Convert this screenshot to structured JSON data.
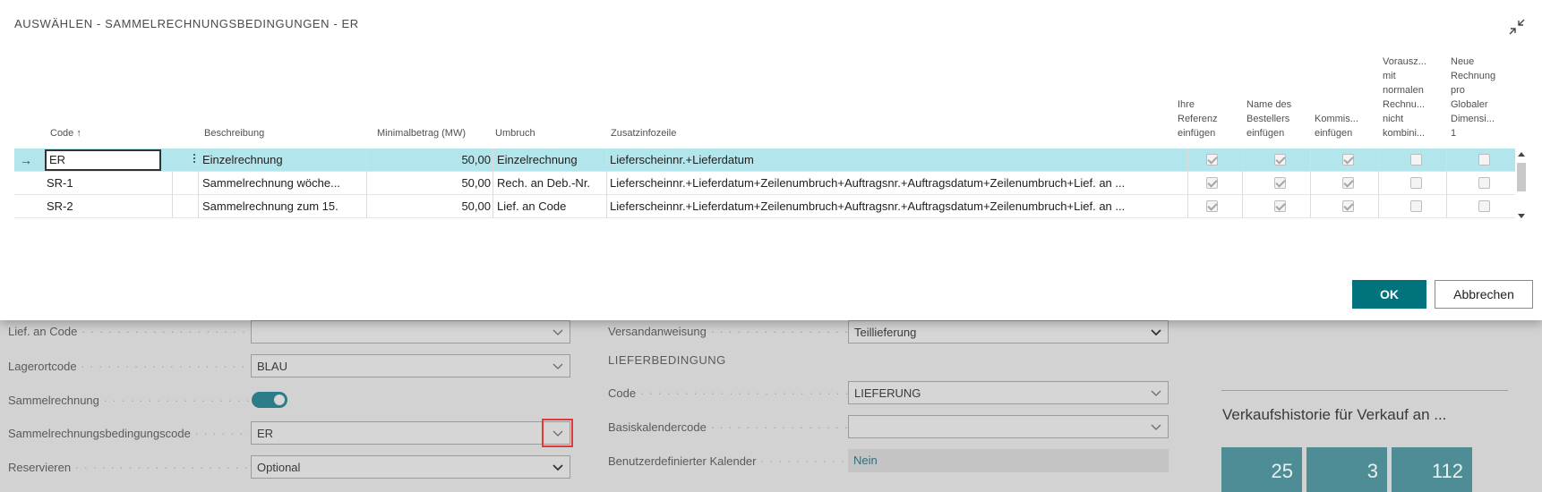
{
  "dialog": {
    "title": "AUSWÄHLEN - SAMMELRECHNUNGSBEDINGUNGEN - ER",
    "ok_label": "OK",
    "cancel_label": "Abbrechen"
  },
  "grid": {
    "columns": {
      "code": "Code",
      "sort_indicator": "↑",
      "beschreibung": "Beschreibung",
      "minimalbetrag": "Minimalbetrag (MW)",
      "umbruch": "Umbruch",
      "zusatzinfozeile": "Zusatzinfozeile",
      "ihre_referenz": [
        "Ihre",
        "Referenz",
        "einfügen"
      ],
      "name_besteller": [
        "Name des",
        "Bestellers",
        "einfügen"
      ],
      "kommis": [
        "Kommis...",
        "einfügen"
      ],
      "vorausz": [
        "Vorausz...",
        "mit",
        "normalen",
        "Rechnu...",
        "nicht",
        "kombini..."
      ],
      "neue_rechnung": [
        "Neue",
        "Rechnung",
        "pro",
        "Globaler",
        "Dimensi...",
        "1"
      ]
    },
    "rows": [
      {
        "code": "ER",
        "beschreibung": "Einzelrechnung",
        "minimalbetrag": "50,00",
        "umbruch": "Einzelrechnung",
        "zusatzinfozeile": "Lieferscheinnr.+Lieferdatum",
        "ihre_referenz": true,
        "name_besteller": true,
        "kommis": true,
        "vorausz": false,
        "neue_rechnung": false
      },
      {
        "code": "SR-1",
        "beschreibung": "Sammelrechnung wöche...",
        "minimalbetrag": "50,00",
        "umbruch": "Rech. an Deb.-Nr.",
        "zusatzinfozeile": "Lieferscheinnr.+Lieferdatum+Zeilenumbruch+Auftragsnr.+Auftragsdatum+Zeilenumbruch+Lief. an ...",
        "ihre_referenz": true,
        "name_besteller": true,
        "kommis": true,
        "vorausz": false,
        "neue_rechnung": false
      },
      {
        "code": "SR-2",
        "beschreibung": "Sammelrechnung zum 15.",
        "minimalbetrag": "50,00",
        "umbruch": "Lief. an Code",
        "zusatzinfozeile": "Lieferscheinnr.+Lieferdatum+Zeilenumbruch+Auftragsnr.+Auftragsdatum+Zeilenumbruch+Lief. an ...",
        "ihre_referenz": true,
        "name_besteller": true,
        "kommis": true,
        "vorausz": false,
        "neue_rechnung": false
      }
    ]
  },
  "background": {
    "left": {
      "lief_an_code_label": "Lief. an Code",
      "lief_an_code_value": "",
      "lagerortcode_label": "Lagerortcode",
      "lagerortcode_value": "BLAU",
      "sammelrechnung_label": "Sammelrechnung",
      "sammelrechnung_on": true,
      "bedingungscode_label": "Sammelrechnungsbedingungscode",
      "bedingungscode_value": "ER",
      "reservieren_label": "Reservieren",
      "reservieren_value": "Optional"
    },
    "right": {
      "versandanweisung_label": "Versandanweisung",
      "versandanweisung_value": "Teillieferung",
      "section_title": "LIEFERBEDINGUNG",
      "code_label": "Code",
      "code_value": "LIEFERUNG",
      "basiskalender_label": "Basiskalendercode",
      "basiskalender_value": "",
      "kalender_label": "Benutzerdefinierter Kalender",
      "kalender_value": "Nein"
    },
    "history": {
      "title": "Verkaufshistorie für Verkauf an ...",
      "tiles": [
        "25",
        "3",
        "112"
      ]
    }
  },
  "colors": {
    "accent": "#00737d",
    "selected_row": "#b3e6ec",
    "tile": "#4e8d96",
    "highlight_box": "#e03a3a"
  }
}
